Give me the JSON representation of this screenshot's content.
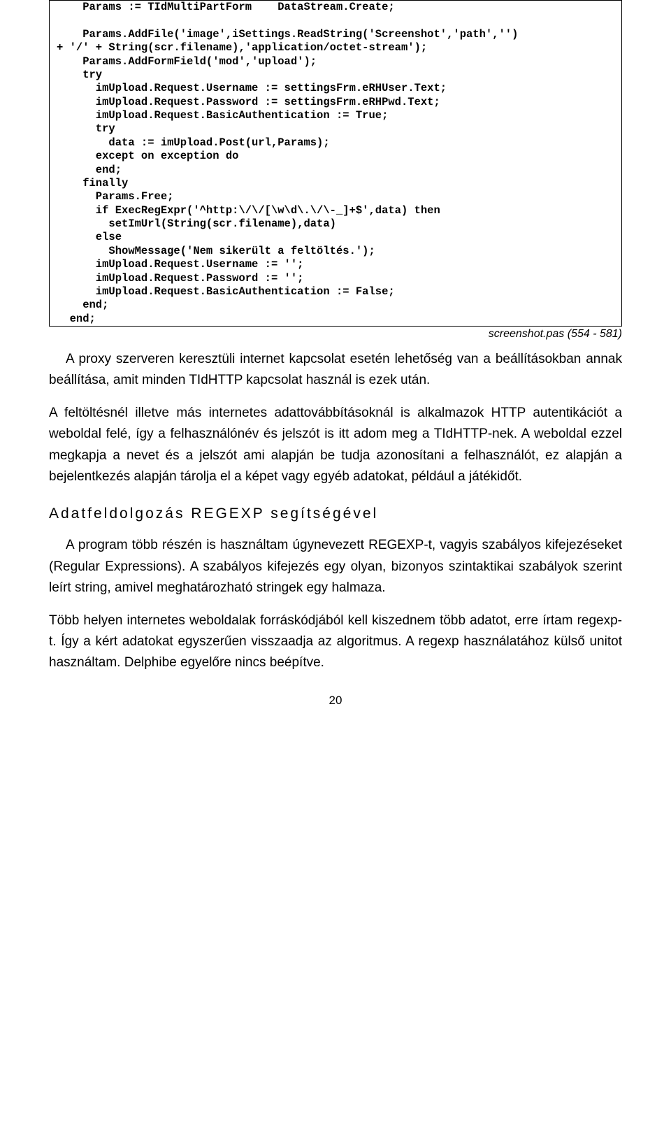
{
  "code_lines": [
    "    Params := TIdMultiPartForm    DataStream.Create;",
    "",
    "    Params.AddFile('image',iSettings.ReadString('Screenshot','path','')",
    "+ '/' + String(scr.filename),'application/octet-stream');",
    "    Params.AddFormField('mod','upload');",
    "    try",
    "      imUpload.Request.Username := settingsFrm.eRHUser.Text;",
    "      imUpload.Request.Password := settingsFrm.eRHPwd.Text;",
    "      imUpload.Request.BasicAuthentication := True;",
    "      try",
    "        data := imUpload.Post(url,Params);",
    "      except on exception do",
    "      end;",
    "    finally",
    "      Params.Free;",
    "      if ExecRegExpr('^http:\\/\\/[\\w\\d\\.\\/\\-_]+$',data) then",
    "        setImUrl(String(scr.filename),data)",
    "      else",
    "        ShowMessage('Nem sikerült a feltöltés.');",
    "      imUpload.Request.Username := '';",
    "      imUpload.Request.Password := '';",
    "      imUpload.Request.BasicAuthentication := False;",
    "    end;",
    "  end;"
  ],
  "caption": "screenshot.pas (554 - 581)",
  "para1": "A proxy szerveren keresztüli internet kapcsolat esetén lehetőség van a beállításokban annak beállítása, amit minden TIdHTTP kapcsolat használ is ezek után.",
  "para2": "A feltöltésnél illetve más internetes adattovábbításoknál is alkalmazok HTTP autentikációt a weboldal felé, így a felhasználónév és jelszót is itt adom meg a TIdHTTP-nek. A weboldal ezzel megkapja a nevet és a jelszót ami alapján be tudja azonosítani a felhasználót, ez alapján a bejelentkezés alapján tárolja el a képet vagy egyéb adatokat, például a játékidőt.",
  "heading": "Adatfeldolgozás REGEXP segítségével",
  "para3": "A program több részén is használtam úgynevezett REGEXP-t, vagyis szabályos kifejezéseket (Regular Expressions). A szabályos kifejezés egy olyan, bizonyos szintaktikai szabályok szerint leírt string, amivel meghatározható stringek egy halmaza.",
  "para4": "Több helyen internetes weboldalak forráskódjából kell kiszednem több adatot, erre írtam regexp-t. Így a kért adatokat egyszerűen visszaadja az algoritmus. A regexp használatához külső unitot használtam. Delphibe egyelőre nincs beépítve.",
  "page_number": "20"
}
